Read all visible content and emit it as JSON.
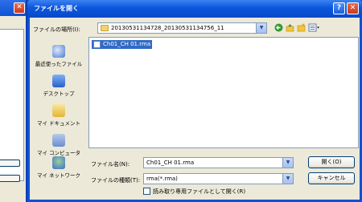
{
  "background_window": {
    "close_glyph": "✕"
  },
  "dialog": {
    "title": "ファイルを開く",
    "help_glyph": "?",
    "close_glyph": "✕"
  },
  "lookin": {
    "label": "ファイルの場所(I):",
    "value": "20130531134728_20130531134756_11",
    "dropdown_glyph": "▼"
  },
  "toolbar": {
    "back_icon": "back-icon",
    "up_icon": "up-folder-icon",
    "newfolder_icon": "new-folder-icon",
    "views_icon": "views-menu-icon"
  },
  "places": [
    {
      "label": "最近使ったファイル",
      "icon": "recent-icon",
      "color": "#4a7bd0"
    },
    {
      "label": "デスクトップ",
      "icon": "desktop-icon",
      "color": "#3a74d6"
    },
    {
      "label": "マイ ドキュメント",
      "icon": "my-documents-icon",
      "color": "#e9c24a"
    },
    {
      "label": "マイ コンピュータ",
      "icon": "my-computer-icon",
      "color": "#6a8ed0"
    },
    {
      "label": "マイ ネットワーク",
      "icon": "my-network-icon",
      "color": "#3d8f3d"
    }
  ],
  "files": [
    {
      "name": "Ch01_CH 01.rma",
      "selected": true
    }
  ],
  "filename": {
    "label": "ファイル名(N):",
    "value": "Ch01_CH 01.rma"
  },
  "filetype": {
    "label": "ファイルの種類(T):",
    "value": "rma(*.rma)"
  },
  "buttons": {
    "open": "開く(O)",
    "cancel": "キャンセル"
  },
  "readonly": {
    "label": "読み取り専用ファイルとして開く(R)",
    "checked": false
  },
  "colors": {
    "titlebar": "#0a56dd",
    "selection": "#316ac5",
    "face": "#ece9d8"
  }
}
